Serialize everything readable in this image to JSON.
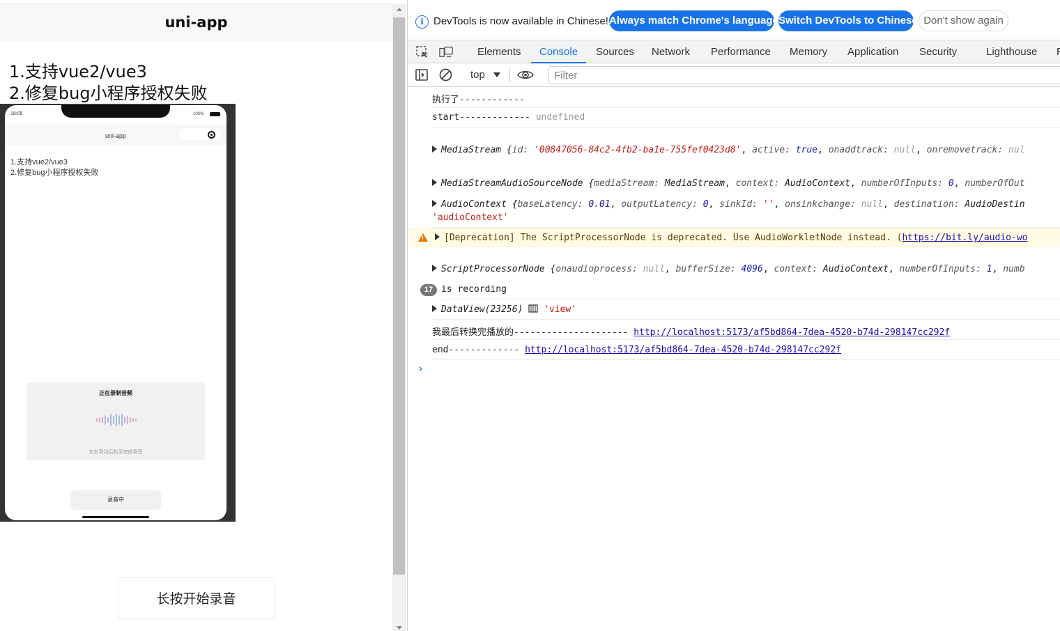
{
  "app": {
    "nav_title": "uni-app",
    "text_lines": [
      "1.支持vue2/vue3",
      "2.修复bug小程序授权失败"
    ],
    "record_button": "长按开始录音"
  },
  "phone": {
    "time": "18:05",
    "battery": "100%",
    "nav_title": "uni-app",
    "text_lines": [
      "1.支持vue2/vue3",
      "2.修复bug小程序授权失败"
    ],
    "popup_title": "正在录制音频",
    "popup_hint": "左右滑动后松手完成录音",
    "record_button": "录音中"
  },
  "devtools": {
    "infobar": {
      "icon": "info-icon",
      "text": "DevTools is now available in Chinese!",
      "match_button": "Always match Chrome's language",
      "switch_button": "Switch DevTools to Chinese",
      "dismiss_button": "Don't show again"
    },
    "tabs": [
      "Elements",
      "Console",
      "Sources",
      "Network",
      "Performance",
      "Memory",
      "Application",
      "Security",
      "Lighthouse",
      "R"
    ],
    "active_tab": "Console",
    "toolbar": {
      "context": "top",
      "filter_placeholder": "Filter"
    },
    "console": {
      "line1": "执行了------------",
      "line2_text": "start-------------",
      "line2_value": "undefined",
      "mediastream": {
        "type": "MediaStream",
        "id_key": "id",
        "id_val": "'00847056-84c2-4fb2-ba1e-755fef0423d8'",
        "active_key": "active",
        "active_val": "true",
        "onaddtrack_key": "onaddtrack",
        "onaddtrack_val": "null",
        "onremovetrack_key": "onremovetrack",
        "onremovetrack_val": "nul"
      },
      "sourcenode": {
        "type": "MediaStreamAudioSourceNode",
        "k1": "mediaStream",
        "v1": "MediaStream",
        "k2": "context",
        "v2": "AudioContext",
        "k3": "numberOfInputs",
        "v3": "0",
        "k4": "numberOfOut"
      },
      "audioctx": {
        "type": "AudioContext",
        "k1": "baseLatency",
        "v1": "0.01",
        "k2": "outputLatency",
        "v2": "0",
        "k3": "sinkId",
        "v3": "''",
        "k4": "onsinkchange",
        "v4": "null",
        "k5": "destination",
        "v5": "AudioDestin",
        "label": "'audioContext'"
      },
      "warning": {
        "text": "[Deprecation] The ScriptProcessorNode is deprecated. Use AudioWorkletNode instead. (",
        "link": "https://bit.ly/audio-wo"
      },
      "processor": {
        "type": "ScriptProcessorNode",
        "k1": "onaudioprocess",
        "v1": "null",
        "k2": "bufferSize",
        "v2": "4096",
        "k3": "context",
        "v3": "AudioContext",
        "k4": "numberOfInputs",
        "v4": "1",
        "k5": "numb"
      },
      "recording": {
        "count": "17",
        "text": "is recording"
      },
      "dataview": {
        "type": "DataView(23256)",
        "label": "'view'"
      },
      "final_line": {
        "text": "我最后转换完播放的---------------------",
        "link": "http://localhost:5173/af5bd864-7dea-4520-b74d-298147cc292f"
      },
      "end_line": {
        "text": "end-------------",
        "link": "http://localhost:5173/af5bd864-7dea-4520-b74d-298147cc292f"
      },
      "prompt": "›"
    }
  },
  "colors": {
    "accent": "#1a73e8",
    "warning_bg": "#fffbe5",
    "string": "#c41a16",
    "number": "#1a1aa6"
  }
}
